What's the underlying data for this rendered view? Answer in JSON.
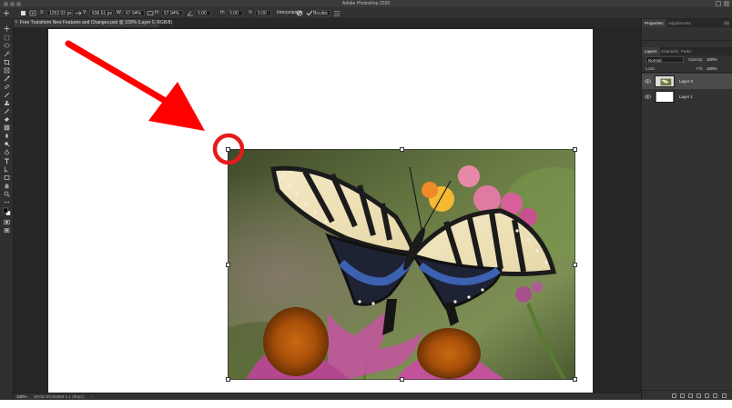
{
  "window": {
    "title": "Adobe Photoshop 2020"
  },
  "options_bar": {
    "x_label": "X:",
    "x_value": "1252.02 px",
    "y_label": "Y:",
    "y_value": "636.61 px",
    "w_label": "W:",
    "w_value": "67.94%",
    "h_label": "H:",
    "h_value": "67.94%",
    "angle_value": "0.00",
    "hskew_label": "H:",
    "hskew_value": "0.00",
    "vskew_label": "V:",
    "vskew_value": "0.00",
    "interpolation_label": "Interpolation:",
    "interpolation_value": "Bicubic"
  },
  "document_tab": {
    "close": "×",
    "title": "Free Transform New Features and Changes.psd @ 100% (Layer 0, RGB/8)"
  },
  "status_bar": {
    "zoom": "100%",
    "profile": "sRGB IEC61966-2.1 (8bpc)",
    "arrow": "›"
  },
  "panel": {
    "tabs": [
      "Properties",
      "Adjustments"
    ],
    "layer_tabs": [
      "Layers",
      "Channels",
      "Paths"
    ],
    "blend_mode": "Normal",
    "opacity_label": "Opacity:",
    "opacity_value": "100%",
    "lock_label": "Lock:",
    "fill_label": "Fill:",
    "fill_value": "100%",
    "layers": [
      {
        "name": "Layer 0",
        "selected": true
      },
      {
        "name": "Layer 1",
        "selected": false
      }
    ]
  },
  "annotation": {
    "arrow_color": "#ff0000",
    "circle_color": "#e61b1b"
  },
  "colors": {
    "ui_dark": "#323232",
    "canvas_bg": "#262626",
    "document": "#ffffff"
  }
}
